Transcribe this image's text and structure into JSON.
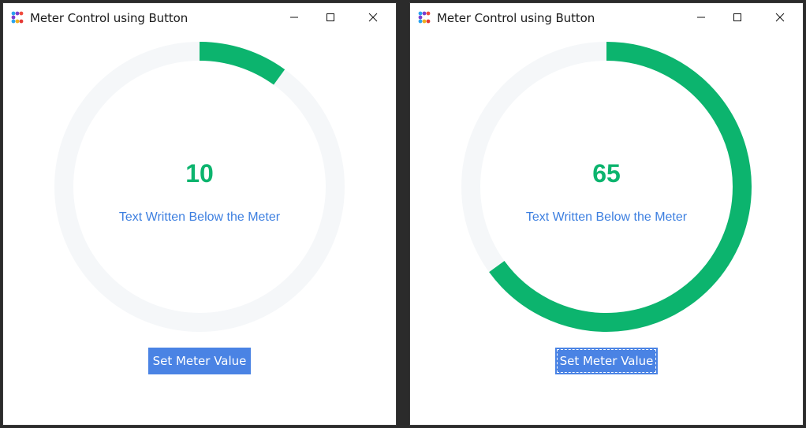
{
  "windows": [
    {
      "title": "Meter Control using Button",
      "meter": {
        "value_text": "10",
        "value": 10,
        "max": 100,
        "subtext": "Text Written Below the Meter"
      },
      "button_label": "Set Meter Value",
      "button_focused": false
    },
    {
      "title": "Meter Control using Button",
      "meter": {
        "value_text": "65",
        "value": 65,
        "max": 100,
        "subtext": "Text Written Below the Meter"
      },
      "button_label": "Set Meter Value",
      "button_focused": true
    }
  ],
  "colors": {
    "meter_fill": "#0cb46e",
    "meter_track": "#f5f7f9",
    "subtext": "#3d7fe0",
    "button_bg": "#4a83e4"
  },
  "icons": {
    "app": "app-dots-icon",
    "minimize": "minimize-icon",
    "maximize": "maximize-icon",
    "close": "close-icon"
  }
}
